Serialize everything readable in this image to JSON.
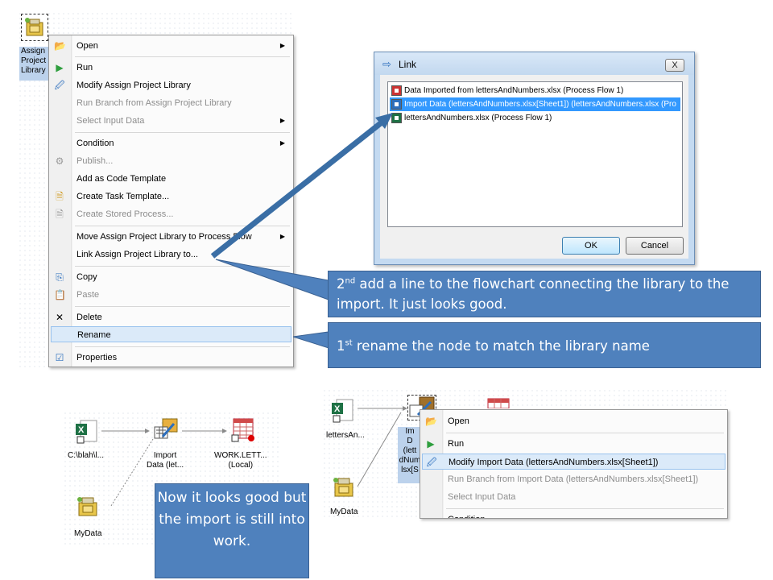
{
  "flow1": {
    "node_label": "Assign\nProject\nLibrary"
  },
  "context_menu": {
    "items": [
      {
        "label": "Open",
        "icon": "folder-open-icon",
        "disabled": false,
        "submenu": true
      },
      {
        "label": "Run",
        "icon": "run-icon",
        "disabled": false,
        "submenu": false
      },
      {
        "label": "Modify Assign Project Library",
        "icon": "modify-icon",
        "disabled": false,
        "submenu": false
      },
      {
        "label": "Run Branch from Assign Project Library",
        "icon": "",
        "disabled": true,
        "submenu": false
      },
      {
        "label": "Select Input Data",
        "icon": "",
        "disabled": true,
        "submenu": true
      },
      {
        "label": "Condition",
        "icon": "",
        "disabled": false,
        "submenu": true
      },
      {
        "label": "Publish...",
        "icon": "publish-icon",
        "disabled": true,
        "submenu": false
      },
      {
        "label": "Add as Code Template",
        "icon": "",
        "disabled": false,
        "submenu": false
      },
      {
        "label": "Create Task Template...",
        "icon": "task-template-icon",
        "disabled": false,
        "submenu": false
      },
      {
        "label": "Create Stored Process...",
        "icon": "stored-process-icon",
        "disabled": true,
        "submenu": false
      },
      {
        "label": "Move Assign Project Library to Process Flow",
        "icon": "",
        "disabled": false,
        "submenu": true
      },
      {
        "label": "Link Assign Project Library to...",
        "icon": "",
        "disabled": false,
        "submenu": false
      },
      {
        "label": "Copy",
        "icon": "copy-icon",
        "disabled": false,
        "submenu": false
      },
      {
        "label": "Paste",
        "icon": "paste-icon",
        "disabled": true,
        "submenu": false
      },
      {
        "label": "Delete",
        "icon": "delete-icon",
        "disabled": false,
        "submenu": false
      },
      {
        "label": "Rename",
        "icon": "",
        "disabled": false,
        "submenu": false,
        "highlighted": true
      },
      {
        "label": "Properties",
        "icon": "properties-icon",
        "disabled": false,
        "submenu": false
      }
    ]
  },
  "dialog": {
    "title": "Link",
    "close_label": "X",
    "list": [
      "Data Imported from lettersAndNumbers.xlsx (Process Flow 1)",
      "Import Data (lettersAndNumbers.xlsx[Sheet1]) (lettersAndNumbers.xlsx (Pro",
      "lettersAndNumbers.xlsx (Process Flow 1)"
    ],
    "selected_index": 1,
    "ok_label": "OK",
    "cancel_label": "Cancel"
  },
  "callouts": {
    "second_num": "2",
    "second_sup": "nd",
    "second_text": " add a line to the flowchart connecting the library to the import.  It just looks good.",
    "first_num": "1",
    "first_sup": "st",
    "first_text": " rename the node to match the library name",
    "third_text": "Now it looks good but the import is still into work."
  },
  "flow2": {
    "source_label": "C:\\blah\\l...",
    "import_label": "Import\nData (let...",
    "output_label": "WORK.LETT...\n(Local)",
    "library_label": "MyData"
  },
  "flow3": {
    "source_label": "lettersAn...",
    "library_label": "MyData",
    "partial_node_label": "Im\nD\n(lett\ndNum\nlsx[S",
    "menu": [
      {
        "label": "Open",
        "icon": "folder-open-icon",
        "disabled": false
      },
      {
        "label": "Run",
        "icon": "run-icon",
        "disabled": false
      },
      {
        "label": "Modify Import Data (lettersAndNumbers.xlsx[Sheet1])",
        "icon": "modify-icon",
        "disabled": false,
        "highlighted": true
      },
      {
        "label": "Run Branch from Import Data (lettersAndNumbers.xlsx[Sheet1])",
        "icon": "",
        "disabled": true
      },
      {
        "label": "Select Input Data",
        "icon": "",
        "disabled": true
      },
      {
        "label": "Condition",
        "icon": "",
        "disabled": false
      }
    ]
  },
  "colors": {
    "callout": "#4f81bd",
    "selection": "#3399ff",
    "menu_highlight": "#dbeaf9"
  }
}
